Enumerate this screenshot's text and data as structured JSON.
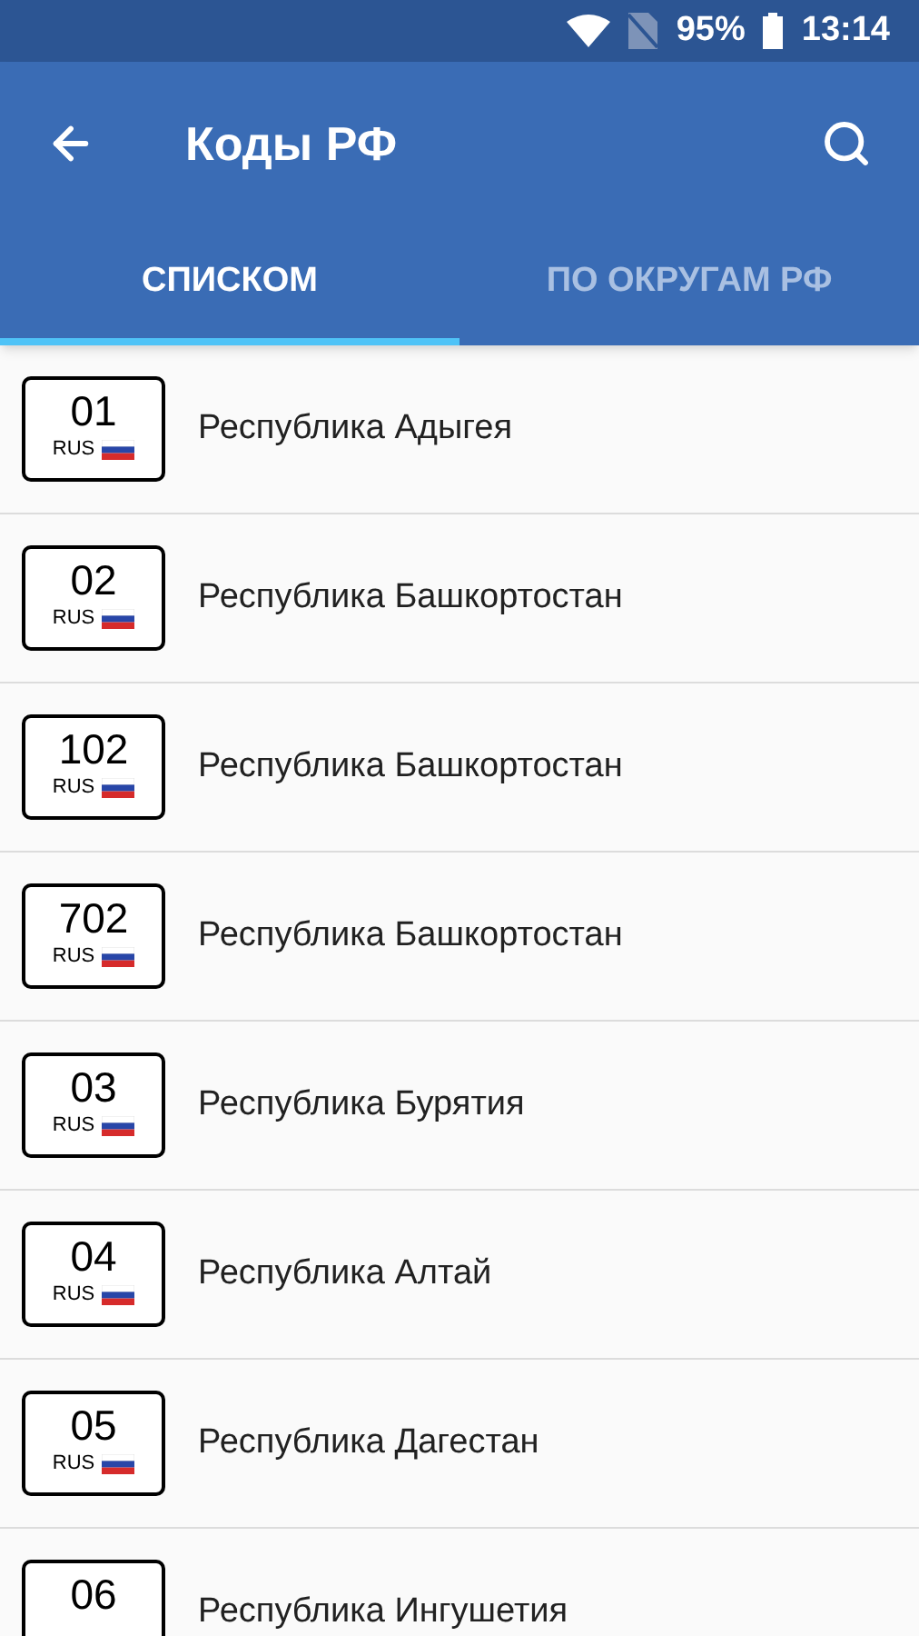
{
  "status_bar": {
    "battery": "95%",
    "time": "13:14"
  },
  "toolbar": {
    "title": "Коды РФ"
  },
  "tabs": [
    {
      "label": "СПИСКОМ",
      "selected": true
    },
    {
      "label": "ПО ОКРУГАМ РФ",
      "selected": false
    }
  ],
  "regions": [
    {
      "code": "01",
      "country": "RUS",
      "name": "Республика Адыгея"
    },
    {
      "code": "02",
      "country": "RUS",
      "name": "Республика Башкортостан"
    },
    {
      "code": "102",
      "country": "RUS",
      "name": "Республика Башкортостан"
    },
    {
      "code": "702",
      "country": "RUS",
      "name": "Республика Башкортостан"
    },
    {
      "code": "03",
      "country": "RUS",
      "name": "Республика Бурятия"
    },
    {
      "code": "04",
      "country": "RUS",
      "name": "Республика Алтай"
    },
    {
      "code": "05",
      "country": "RUS",
      "name": "Республика Дагестан"
    },
    {
      "code": "06",
      "name": "Республика Ингушетия"
    }
  ]
}
